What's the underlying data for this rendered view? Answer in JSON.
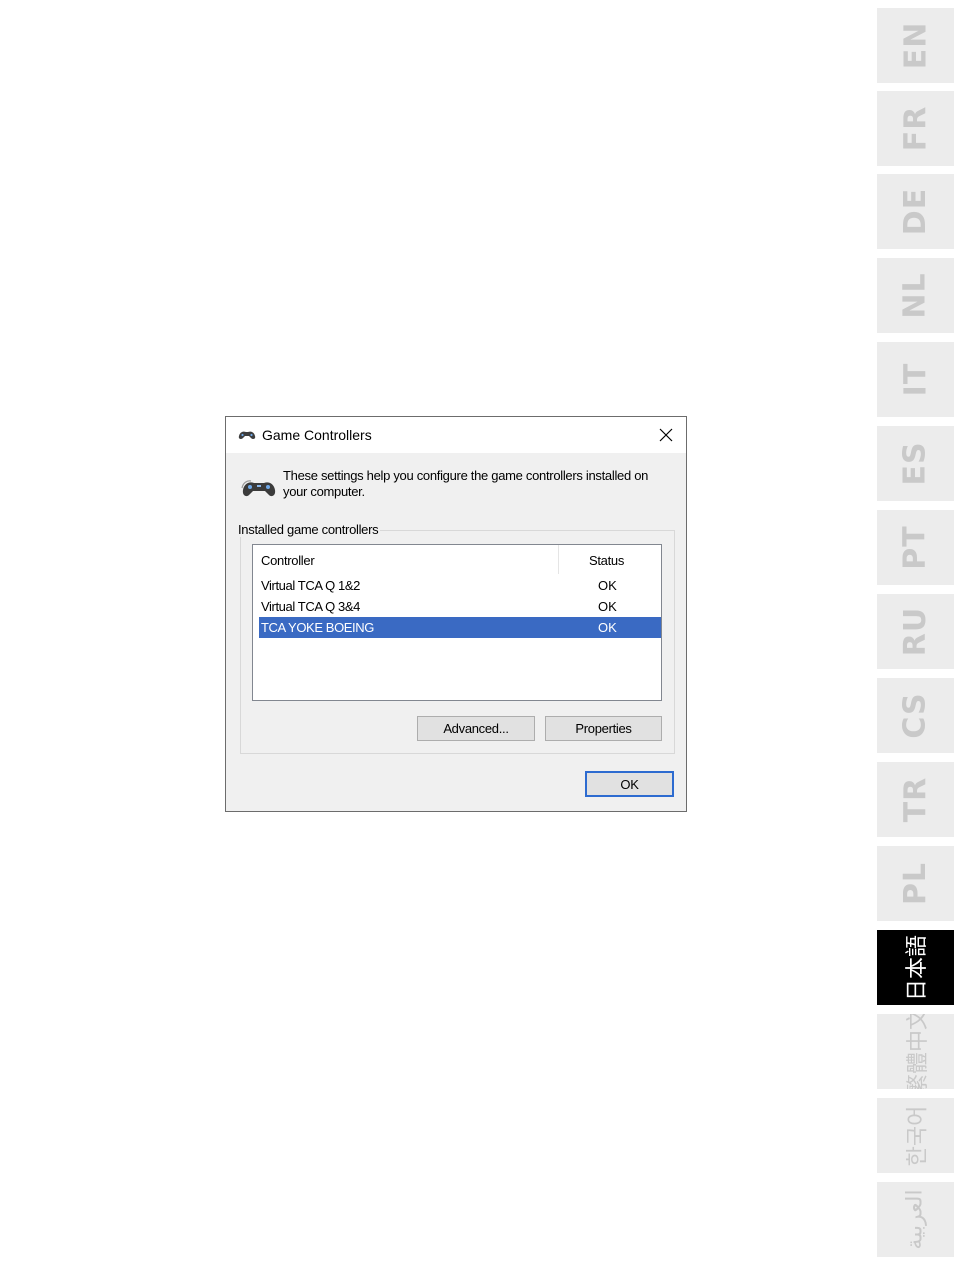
{
  "language_tabs": [
    {
      "label": "EN",
      "active": false
    },
    {
      "label": "FR",
      "active": false
    },
    {
      "label": "DE",
      "active": false
    },
    {
      "label": "NL",
      "active": false
    },
    {
      "label": "IT",
      "active": false
    },
    {
      "label": "ES",
      "active": false
    },
    {
      "label": "PT",
      "active": false
    },
    {
      "label": "RU",
      "active": false
    },
    {
      "label": "CS",
      "active": false
    },
    {
      "label": "TR",
      "active": false
    },
    {
      "label": "PL",
      "active": false
    },
    {
      "label": "日本語",
      "active": true
    },
    {
      "label": "繁體中文",
      "active": false
    },
    {
      "label": "한국어",
      "active": false
    },
    {
      "label": "العربية",
      "active": false
    }
  ],
  "dialog": {
    "title": "Game Controllers",
    "title_icon": "gamepad-icon",
    "close_icon": "close-icon",
    "intro_icon": "gamepad-icon",
    "intro_text": "These settings help you configure the game controllers installed on your computer.",
    "group_label": "Installed game controllers",
    "columns": {
      "controller": "Controller",
      "status": "Status"
    },
    "controllers": [
      {
        "name": "Virtual TCA Q 1&2",
        "status": "OK",
        "selected": false
      },
      {
        "name": "Virtual TCA Q 3&4",
        "status": "OK",
        "selected": false
      },
      {
        "name": "TCA YOKE BOEING",
        "status": "OK",
        "selected": true
      }
    ],
    "buttons": {
      "advanced": "Advanced...",
      "properties": "Properties",
      "ok": "OK"
    }
  },
  "colors": {
    "selection": "#3a6ac3",
    "tab_inactive_bg": "#ececec",
    "tab_inactive_text": "#c9c9c9",
    "tab_active_bg": "#000000",
    "tab_active_text": "#ffffff",
    "ok_button_border": "#2d6bd0"
  }
}
